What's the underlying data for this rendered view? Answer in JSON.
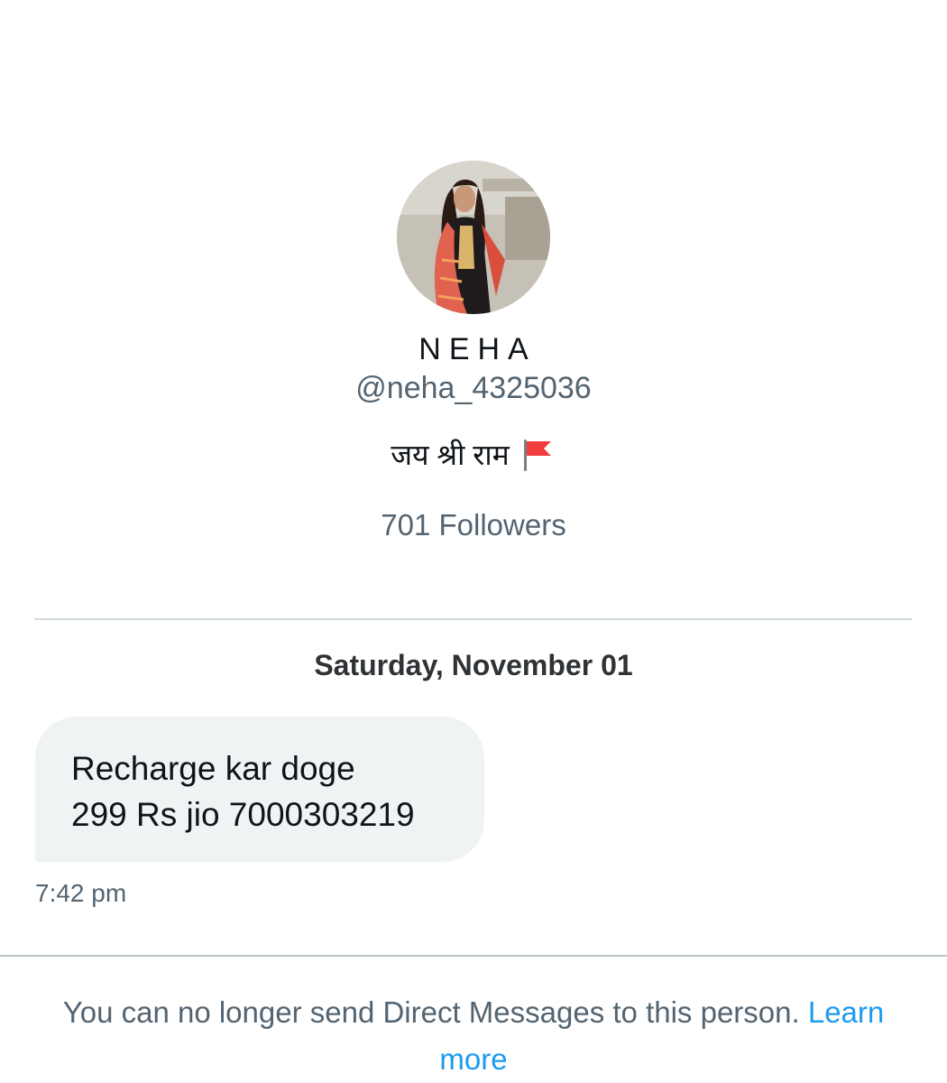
{
  "profile": {
    "display_name": "NEHA",
    "handle": "@neha_4325036",
    "bio": "जय श्री राम",
    "bio_icon": "red-flag-icon",
    "followers": "701 Followers"
  },
  "conversation": {
    "date_header": "Saturday, November 01",
    "messages": [
      {
        "lines": [
          "Recharge kar doge",
          "299 Rs jio 7000303219"
        ],
        "time": "7:42 pm"
      }
    ]
  },
  "footer": {
    "notice": "You can no longer send Direct Messages to this person.",
    "link_label": "Learn more"
  },
  "colors": {
    "primary_text": "#0f1419",
    "secondary_text": "#536471",
    "link": "#1d9bf0",
    "bubble_bg": "#eff3f4",
    "divider": "#cfd9de"
  }
}
